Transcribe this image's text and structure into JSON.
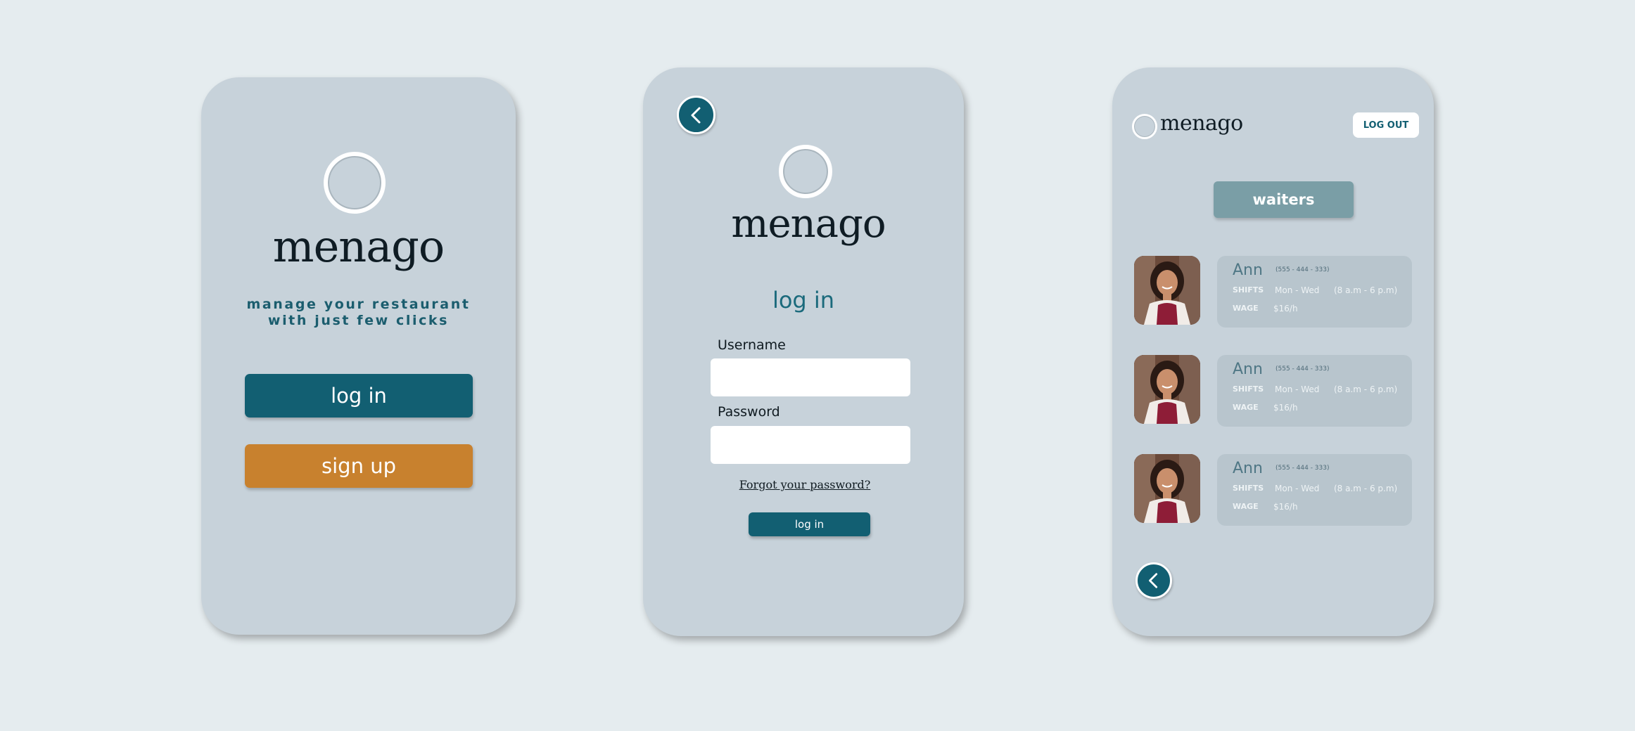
{
  "colors": {
    "background": "#e5ecef",
    "screen": "#c7d2da",
    "primary": "#125f72",
    "accent": "#c8812e",
    "muted_teal": "#7a9ea6"
  },
  "screen1": {
    "brand": "menago",
    "tagline_line1": "manage your restaurant",
    "tagline_line2": "with just few clicks",
    "login_label": "log in",
    "signup_label": "sign up"
  },
  "screen2": {
    "brand": "menago",
    "title": "log in",
    "username_label": "Username",
    "username_value": "",
    "password_label": "Password",
    "password_value": "",
    "forgot_label": "Forgot your password?",
    "login_label": "log in"
  },
  "screen3": {
    "brand": "menago",
    "logout_label": "LOG OUT",
    "section_label": "waiters",
    "waiters": [
      {
        "name": "Ann",
        "phone": "(555 - 444 - 333)",
        "shifts_label": "SHIFTS",
        "shifts_days": "Mon - Wed",
        "shifts_hours": "(8 a.m - 6 p.m)",
        "wage_label": "WAGE",
        "wage": "$16/h"
      },
      {
        "name": "Ann",
        "phone": "(555 - 444 - 333)",
        "shifts_label": "SHIFTS",
        "shifts_days": "Mon - Wed",
        "shifts_hours": "(8 a.m - 6 p.m)",
        "wage_label": "WAGE",
        "wage": "$16/h"
      },
      {
        "name": "Ann",
        "phone": "(555 - 444 - 333)",
        "shifts_label": "SHIFTS",
        "shifts_days": "Mon - Wed",
        "shifts_hours": "(8 a.m - 6 p.m)",
        "wage_label": "WAGE",
        "wage": "$16/h"
      }
    ]
  },
  "icons": {
    "back": "chevron-left-icon",
    "logo": "logo-circle-icon",
    "avatar": "waiter-photo"
  }
}
